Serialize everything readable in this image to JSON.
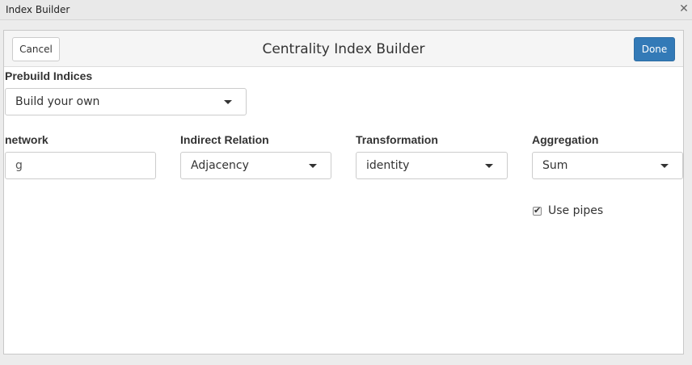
{
  "window": {
    "title": "Index Builder",
    "close_icon": "close-icon"
  },
  "header": {
    "cancel_label": "Cancel",
    "title": "Centrality Index Builder",
    "done_label": "Done"
  },
  "prebuild": {
    "label": "Prebuild Indices",
    "selected": "Build your own"
  },
  "fields": {
    "network": {
      "label": "network",
      "value": "g"
    },
    "indirect_relation": {
      "label": "Indirect Relation",
      "selected": "Adjacency"
    },
    "transformation": {
      "label": "Transformation",
      "selected": "identity"
    },
    "aggregation": {
      "label": "Aggregation",
      "selected": "Sum"
    }
  },
  "options": {
    "use_pipes_label": "Use pipes",
    "use_pipes_checked": true
  },
  "colors": {
    "primary": "#337ab7",
    "header_bg": "#f5f5f5",
    "titlebar_bg": "#e9e9e9"
  }
}
